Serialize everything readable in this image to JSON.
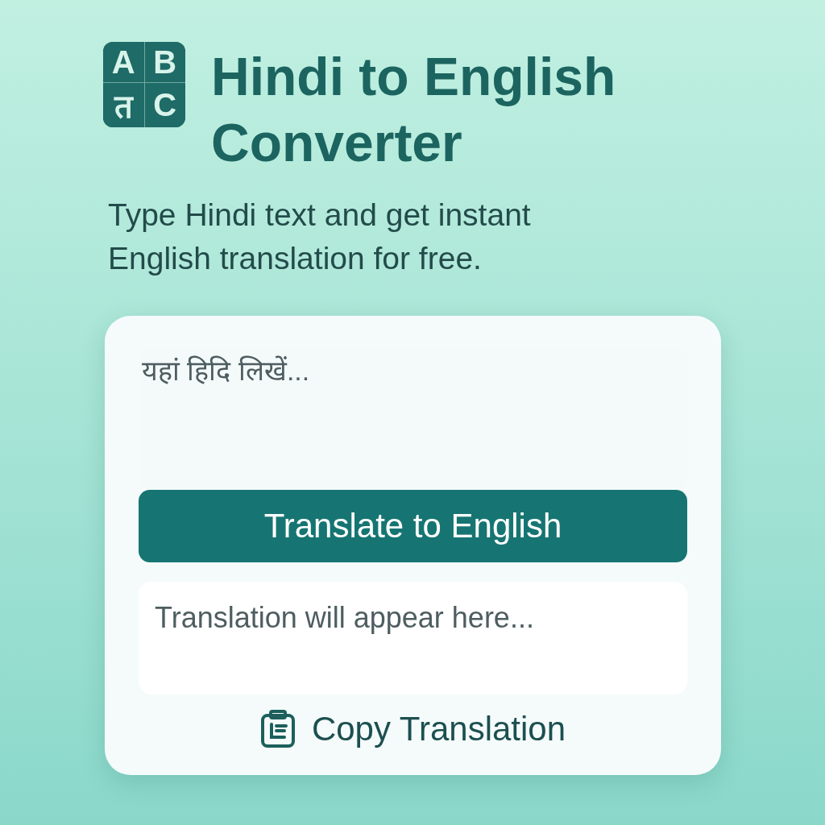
{
  "logo": {
    "letters": [
      "A",
      "B",
      "त",
      "C"
    ]
  },
  "title": "Hindi to English Converter",
  "subtitle": "Type Hindi text and get instant English translation for free.",
  "input": {
    "placeholder": "यहां हिदि लिखें..."
  },
  "translate_button": "Translate to English",
  "output": {
    "placeholder": "Translation will appear here..."
  },
  "copy_button": "Copy Translation"
}
